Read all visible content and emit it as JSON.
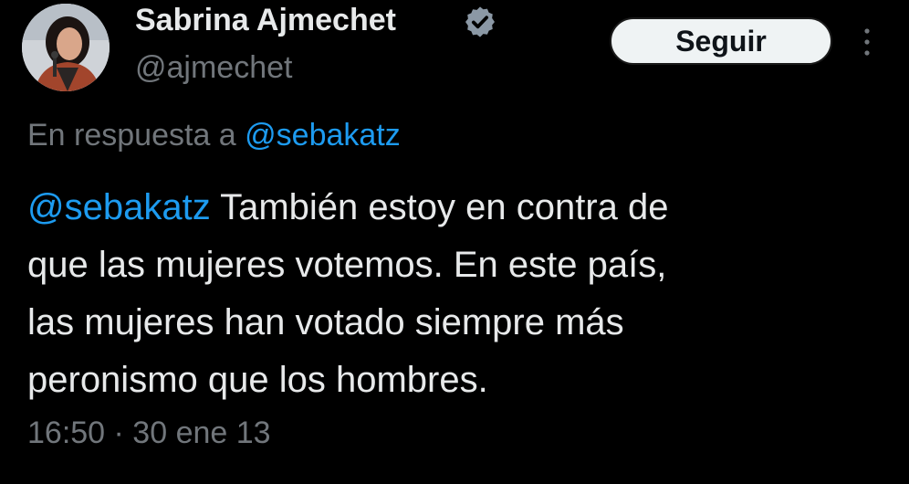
{
  "author": {
    "name": "Sabrina Ajmechet",
    "handle": "@ajmechet",
    "verified": true
  },
  "follow_button": {
    "label": "Seguir"
  },
  "reply": {
    "prefix": "En respuesta a",
    "mention": "@sebakatz"
  },
  "tweet": {
    "mention": "@sebakatz",
    "lines": [
      " También estoy en contra de",
      "que las mujeres votemos. En este país,",
      "las mujeres han votado siempre más",
      "peronismo que los hombres."
    ]
  },
  "meta": {
    "timestamp": "16:50 · 30 ene 13"
  },
  "icons": {
    "verified": "verified-badge-icon",
    "more": "more-vertical-icon"
  },
  "colors": {
    "background": "#000000",
    "text": "#e7e9ea",
    "secondary": "#71767b",
    "link": "#1d9bf0",
    "button_bg": "#eff3f4"
  }
}
